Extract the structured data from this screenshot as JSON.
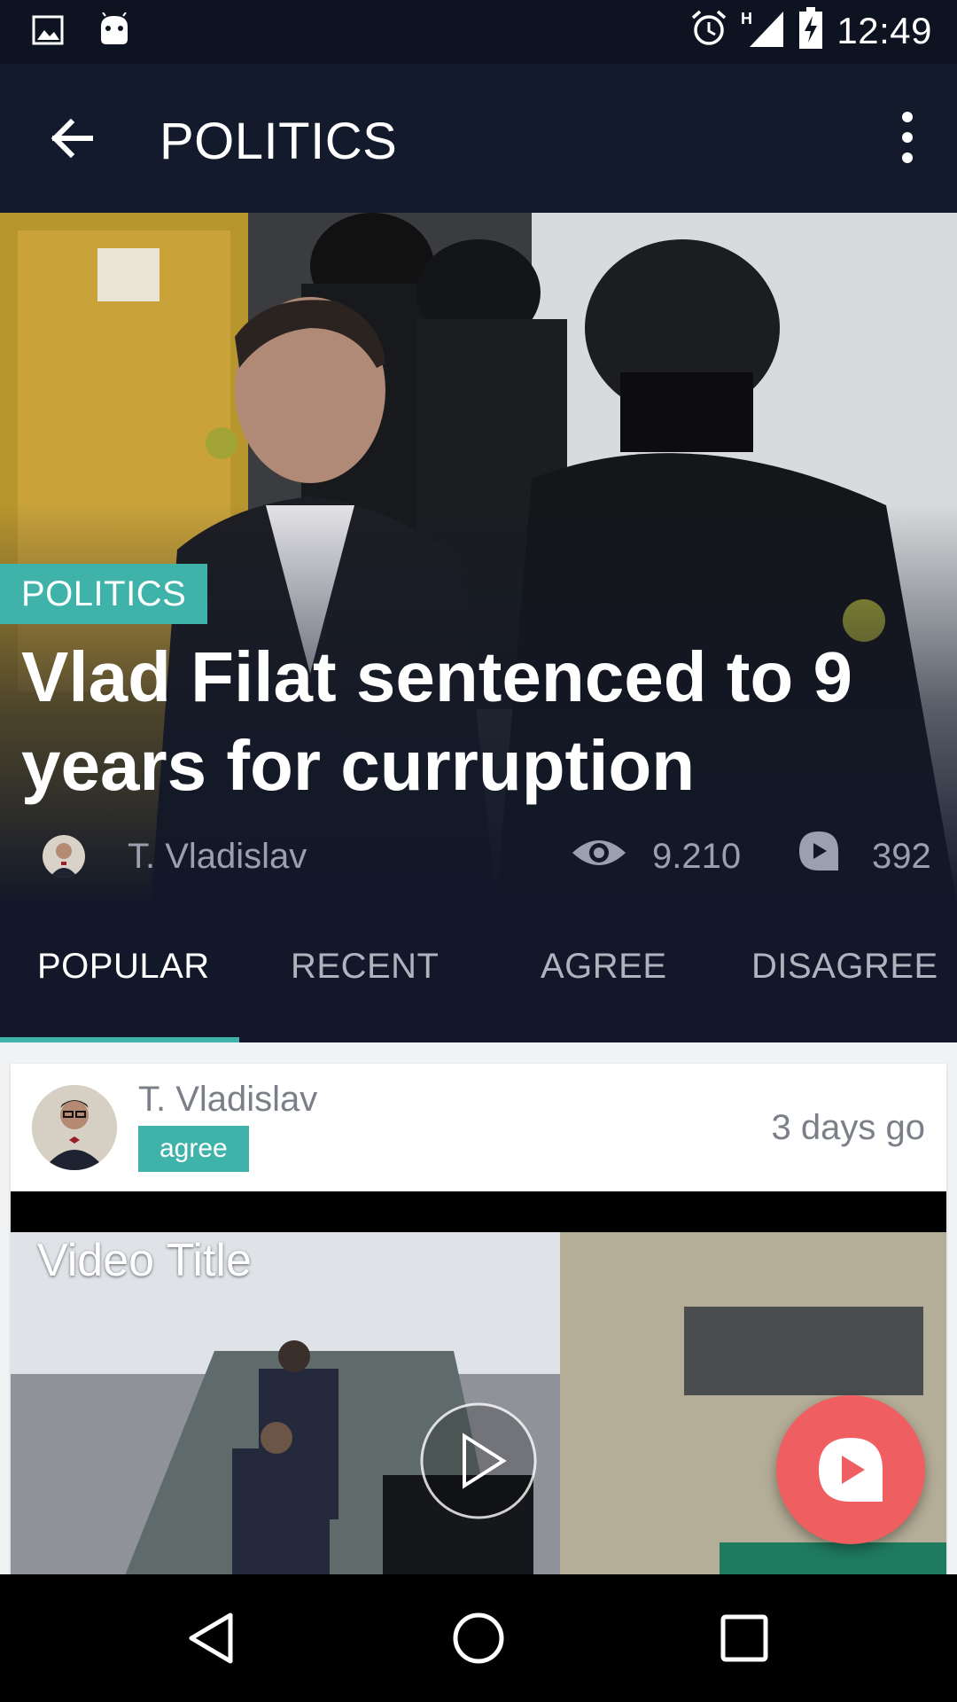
{
  "status_bar": {
    "time": "12:49",
    "network": "H",
    "icons": [
      "image-icon",
      "android-icon",
      "alarm-icon",
      "signal-icon",
      "battery-charging-icon"
    ]
  },
  "app_bar": {
    "title": "POLITICS",
    "back_icon": "arrow-back-icon",
    "menu_icon": "more-vert-icon"
  },
  "article": {
    "category": "POLITICS",
    "headline": "Vlad Filat sentenced to 9 years for curruption",
    "author": "T. Vladislav",
    "views": "9.210",
    "comments": "392"
  },
  "tabs": [
    {
      "label": "POPULAR",
      "active": true
    },
    {
      "label": "RECENT",
      "active": false
    },
    {
      "label": "AGREE",
      "active": false
    },
    {
      "label": "DISAGREE",
      "active": false
    }
  ],
  "feed": [
    {
      "author": "T. Vladislav",
      "stance": "agree",
      "time": "3 days go",
      "video_title": "Video Title"
    }
  ],
  "colors": {
    "accent": "#3fb3a9",
    "fab": "#ef5f62",
    "background": "#121829"
  }
}
